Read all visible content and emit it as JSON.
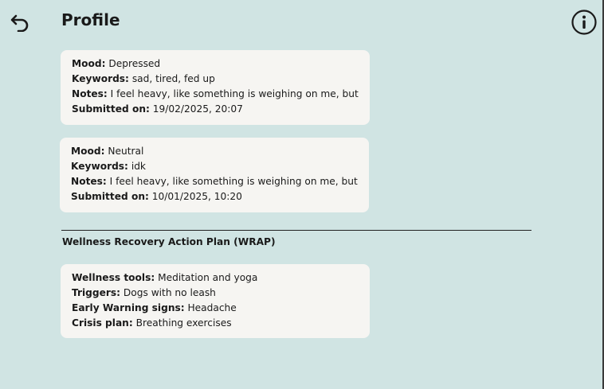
{
  "header": {
    "title": "Profile",
    "back_icon": "undo-arrow-icon",
    "info_icon": "info-circle-icon"
  },
  "entries": [
    {
      "mood_label": "Mood:",
      "mood": "Depressed",
      "keywords_label": "Keywords:",
      "keywords": "sad, tired, fed up",
      "notes_label": "Notes:",
      "notes": "I feel heavy, like something is weighing on me, but ...",
      "submitted_label": "Submitted on:",
      "submitted": "19/02/2025, 20:07"
    },
    {
      "mood_label": "Mood:",
      "mood": "Neutral",
      "keywords_label": "Keywords:",
      "keywords": "idk",
      "notes_label": "Notes:",
      "notes": "I feel heavy, like something is weighing on me, but ...",
      "submitted_label": "Submitted on:",
      "submitted": "10/01/2025, 10:20"
    }
  ],
  "wrap": {
    "title": "Wellness Recovery Action Plan (WRAP)",
    "tools_label": "Wellness tools:",
    "tools": "Meditation and yoga",
    "triggers_label": "Triggers:",
    "triggers": "Dogs with no leash",
    "warning_label": "Early Warning signs:",
    "warning": "Headache",
    "crisis_label": "Crisis plan:",
    "crisis": "Breathing exercises"
  },
  "colors": {
    "background": "#d0e4e3",
    "card": "#f6f5f2",
    "text": "#1a1a1a"
  }
}
